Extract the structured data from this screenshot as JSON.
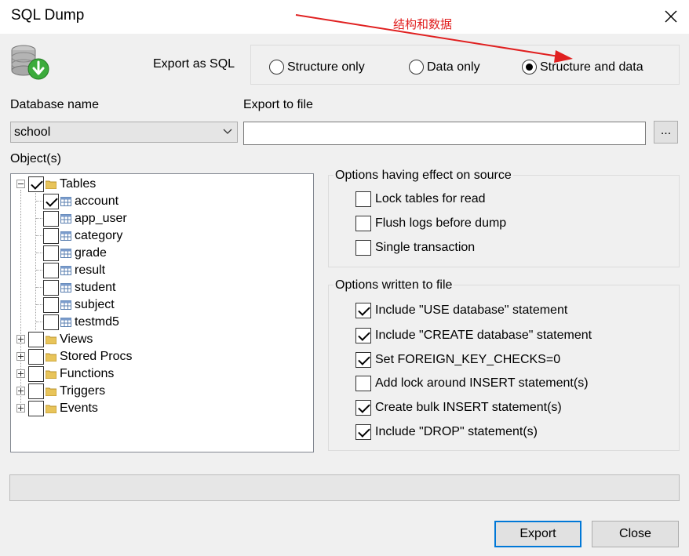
{
  "window": {
    "title": "SQL Dump"
  },
  "export_as": {
    "label": "Export as SQL",
    "options": [
      "Structure only",
      "Data only",
      "Structure and data"
    ],
    "selected": "Structure and data"
  },
  "database": {
    "label": "Database name",
    "value": "school"
  },
  "export_file": {
    "label": "Export to file",
    "value": "",
    "browse_label": "..."
  },
  "objects": {
    "label": "Object(s)",
    "tree": [
      {
        "label": "Tables",
        "checked": true,
        "expanded": true,
        "children": [
          {
            "label": "account",
            "checked": true
          },
          {
            "label": "app_user",
            "checked": false
          },
          {
            "label": "category",
            "checked": false
          },
          {
            "label": "grade",
            "checked": false
          },
          {
            "label": "result",
            "checked": false
          },
          {
            "label": "student",
            "checked": false
          },
          {
            "label": "subject",
            "checked": false
          },
          {
            "label": "testmd5",
            "checked": false
          }
        ]
      },
      {
        "label": "Views",
        "checked": false,
        "expanded": false
      },
      {
        "label": "Stored Procs",
        "checked": false,
        "expanded": false
      },
      {
        "label": "Functions",
        "checked": false,
        "expanded": false
      },
      {
        "label": "Triggers",
        "checked": false,
        "expanded": false
      },
      {
        "label": "Events",
        "checked": false,
        "expanded": false
      }
    ]
  },
  "source_options": {
    "title": "Options having effect on source",
    "items": [
      {
        "label": "Lock tables for read",
        "checked": false
      },
      {
        "label": "Flush logs before dump",
        "checked": false
      },
      {
        "label": "Single transaction",
        "checked": false
      }
    ]
  },
  "file_options": {
    "title": "Options written to file",
    "items": [
      {
        "label": "Include \"USE database\" statement",
        "checked": true
      },
      {
        "label": "Include \"CREATE database\" statement",
        "checked": true
      },
      {
        "label": "Set FOREIGN_KEY_CHECKS=0",
        "checked": true
      },
      {
        "label": "Add lock around INSERT statement(s)",
        "checked": false
      },
      {
        "label": "Create bulk INSERT statement(s)",
        "checked": true
      },
      {
        "label": "Include \"DROP\" statement(s)",
        "checked": true
      }
    ]
  },
  "progress": {
    "value": 0
  },
  "buttons": {
    "export": "Export",
    "close": "Close"
  },
  "annotation": {
    "text": "结构和数据",
    "color": "#e02020"
  }
}
